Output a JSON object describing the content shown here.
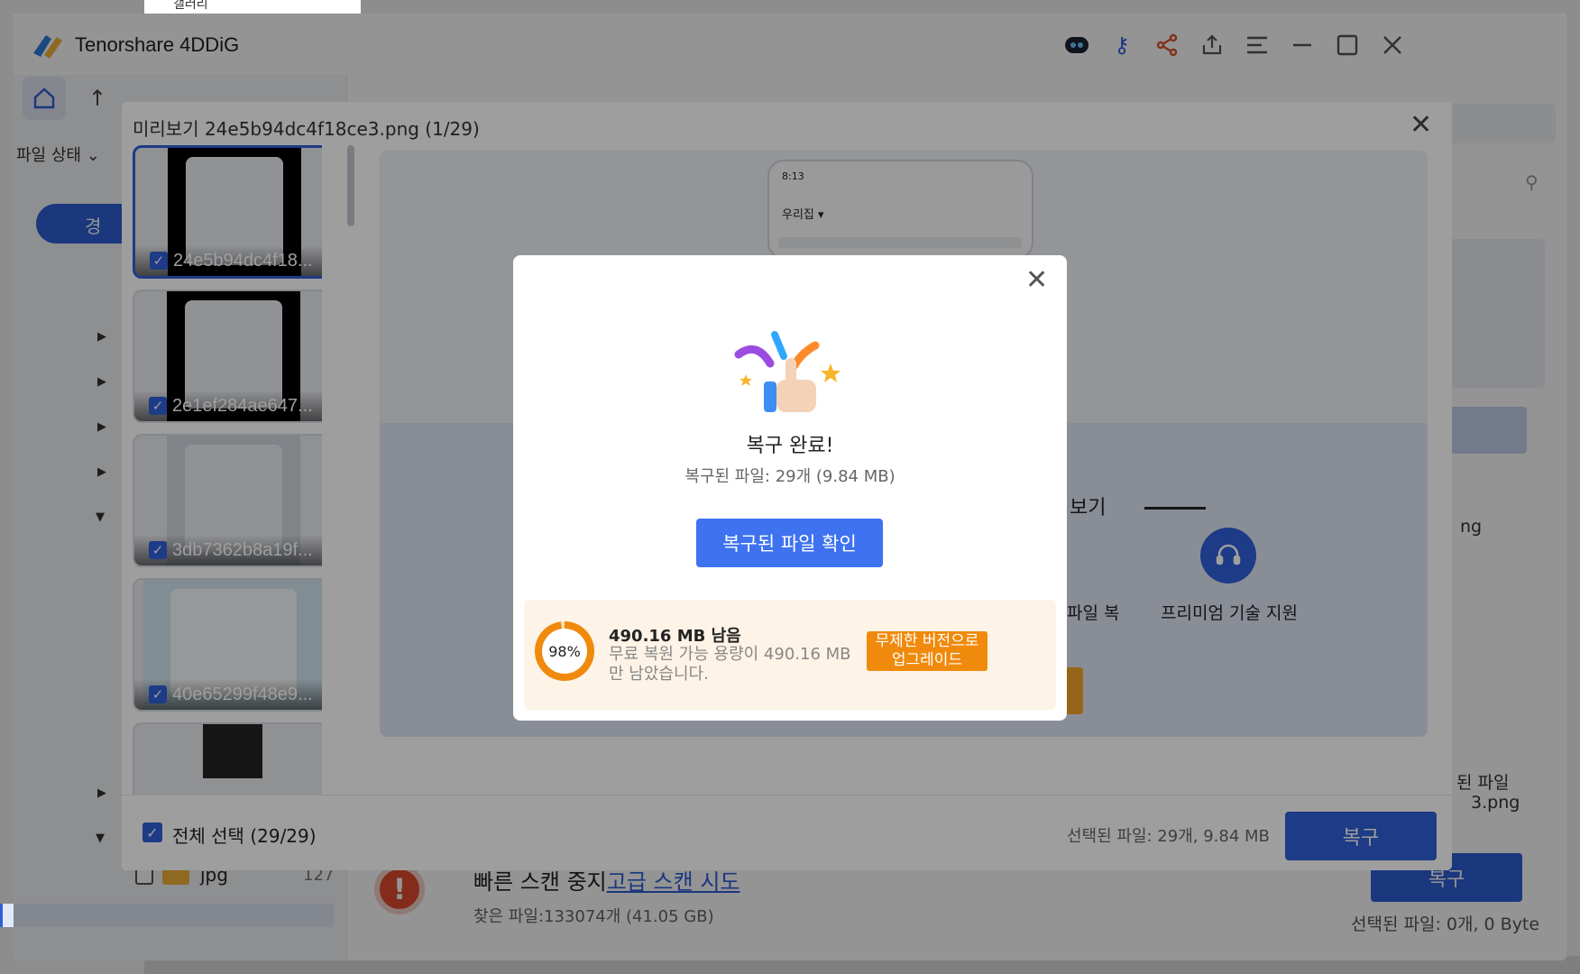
{
  "app": {
    "title": "Tenorshare 4DDiG",
    "top_fragment": "갤러리"
  },
  "background": {
    "file_status_label": "파일 상태",
    "pill_label": "경",
    "tree_item": {
      "name": "jpg",
      "count": "127"
    },
    "scan_text": "빠른 스캔 중지",
    "scan_link": "고급 스캔 시도",
    "found_text": "찾은 파일:133074개 (41.05 GB)",
    "recover_label": "복구",
    "selected_info": "선택된 파일: 0개, 0 Byte",
    "right_label1": "된 파일",
    "right_label2": "3.png",
    "right_label3": "ng"
  },
  "preview": {
    "title": "미리보기 24e5b94dc4f18ce3.png (1/29)",
    "thumbnails": [
      {
        "name": "24e5b94dc4f18..."
      },
      {
        "name": "2e1ef284ae647..."
      },
      {
        "name": "3db7362b8a19f..."
      },
      {
        "name": "40e65299f48e9..."
      }
    ],
    "phone_time": "8:13",
    "phone_app": "우리집 ▾",
    "section_fragment": "보기",
    "file_fragment": "파일 복",
    "support_label": "프리미엄 기술 지원",
    "select_all_label": "전체 선택 (29/29)",
    "selected_info": "선택된 파일: 29개, 9.84 MB",
    "recover_label": "복구"
  },
  "dialog": {
    "title": "복구 완료!",
    "subtitle": "복구된 파일: 29개 (9.84 MB)",
    "confirm_label": "복구된 파일 확인",
    "quota": {
      "percent_label": "98%",
      "percent_value": 0.98,
      "remaining": "490.16 MB 남음",
      "description": "무료 복원 가능 용량이 490.16 MB 만 남았습니다.",
      "upgrade_label": "무제한 버전으로 업그레이드"
    }
  },
  "colors": {
    "accent": "#2f5fd8",
    "button_blue": "#3e72f0",
    "orange": "#f08a0c",
    "error_red": "#e24c2f"
  },
  "icons": [
    "home-icon",
    "up-arrow-icon",
    "ai-bot-icon",
    "key-icon",
    "share-icon",
    "export-icon",
    "menu-icon",
    "minimize-icon",
    "maximize-icon",
    "close-icon",
    "filter-icon",
    "check-icon",
    "headset-icon",
    "celebration-icon",
    "alert-icon",
    "folder-icon"
  ]
}
